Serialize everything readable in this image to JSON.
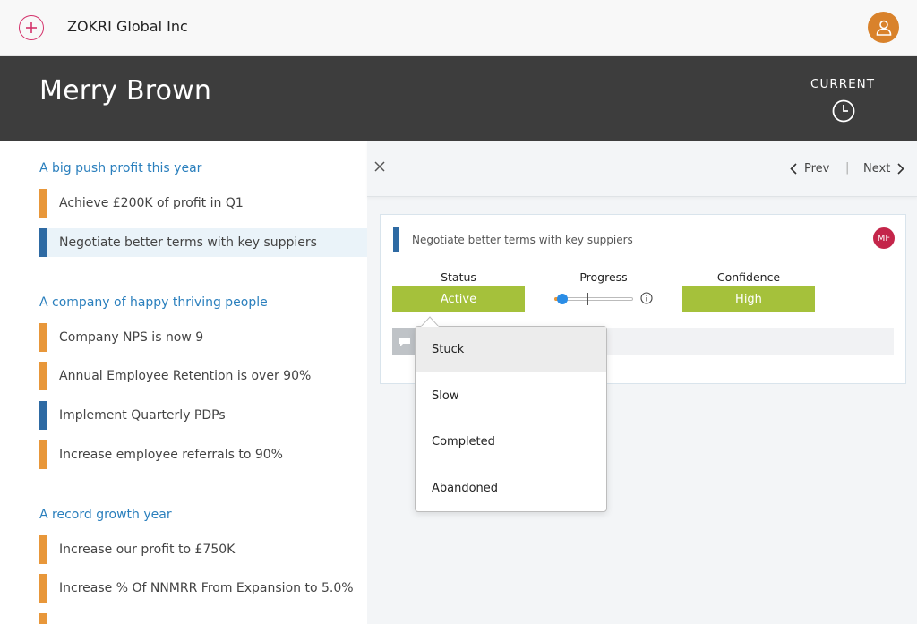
{
  "topbar": {
    "company": "ZOKRI Global Inc",
    "add_icon": "plus-circle-icon",
    "user_icon": "user-icon"
  },
  "header": {
    "person_name": "Merry Brown",
    "current_label": "CURRENT",
    "clock_icon": "clock-icon"
  },
  "objectives": [
    {
      "title": "A big push profit this year",
      "key_results": [
        {
          "label": "Achieve £200K of profit in Q1",
          "color": "#e8973a"
        },
        {
          "label": "Negotiate better terms with key suppiers",
          "color": "#2e6aa3",
          "selected": true
        }
      ]
    },
    {
      "title": "A company of happy thriving people",
      "key_results": [
        {
          "label": "Company NPS is now 9",
          "color": "#e8973a"
        },
        {
          "label": "Annual Employee Retention is over 90%",
          "color": "#e8973a"
        },
        {
          "label": "Implement Quarterly PDPs",
          "color": "#2e6aa3"
        },
        {
          "label": "Increase employee referrals to 90%",
          "color": "#e8973a"
        }
      ]
    },
    {
      "title": "A record growth year",
      "key_results": [
        {
          "label": "Increase our profit to £750K",
          "color": "#e8973a"
        },
        {
          "label": "Increase % Of NNMRR From Expansion to 5.0%",
          "color": "#e8973a"
        }
      ]
    }
  ],
  "panel": {
    "prev_label": "Prev",
    "next_label": "Next",
    "separator": "|",
    "card": {
      "title": "Negotiate better terms with key suppiers",
      "owner_initials": "MF",
      "status_label": "Status",
      "status_value": "Active",
      "progress_label": "Progress",
      "progress_value": 0.1,
      "confidence_label": "Confidence",
      "confidence_value": "High"
    }
  },
  "status_dropdown": {
    "options": [
      "Stuck",
      "Slow",
      "Completed",
      "Abandoned"
    ],
    "highlighted": "Stuck"
  },
  "colors": {
    "accent_blue": "#2a7fbd",
    "status_green": "#a5c13b",
    "header_bg": "#3d3d3d",
    "brand_pink": "#d4326b"
  }
}
